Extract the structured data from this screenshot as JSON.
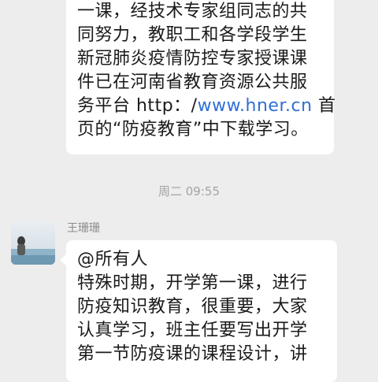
{
  "previous_message": {
    "lines": [
      "一课，经技术专家组同志的共",
      "同努力，教职工和各学段学生",
      "新冠肺炎疫情防控专家授课课",
      "件已在河南省教育资源公共服",
      "务平台 http：/",
      "页的“防疫教育”中下载学习。"
    ],
    "link_text": "www.hner.cn",
    "line5_suffix": " 首"
  },
  "timestamp": "周二 09:55",
  "message": {
    "sender": "王珊珊",
    "lines": [
      "@所有人",
      "特殊时期，开学第一课，进行",
      "防疫知识教育，很重要，大家",
      "认真学习，班主任要写出开学",
      "第一节防疫课的课程设计，讲"
    ]
  },
  "colors": {
    "background": "#ededed",
    "bubble": "#ffffff",
    "link": "#2f6fd6",
    "timestamp": "#a4a4a4"
  }
}
